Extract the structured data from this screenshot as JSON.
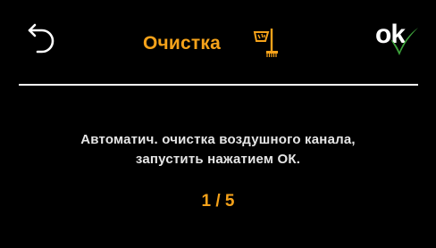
{
  "colors": {
    "background": "#000000",
    "accent": "#f5a21a",
    "text": "#ffffff",
    "check": "#3ea33c"
  },
  "header": {
    "back_icon": "back-arrow-icon",
    "title": "Очистка",
    "title_icon": "duct-cleaning-brush-icon",
    "ok_label": "ok",
    "ok_icon": "checkmark-icon"
  },
  "message": {
    "line1": "Автоматич. очистка воздушного канала,",
    "line2": "запустить нажатием ОК."
  },
  "pager": {
    "current": 1,
    "total": 5,
    "text": "1 / 5"
  }
}
